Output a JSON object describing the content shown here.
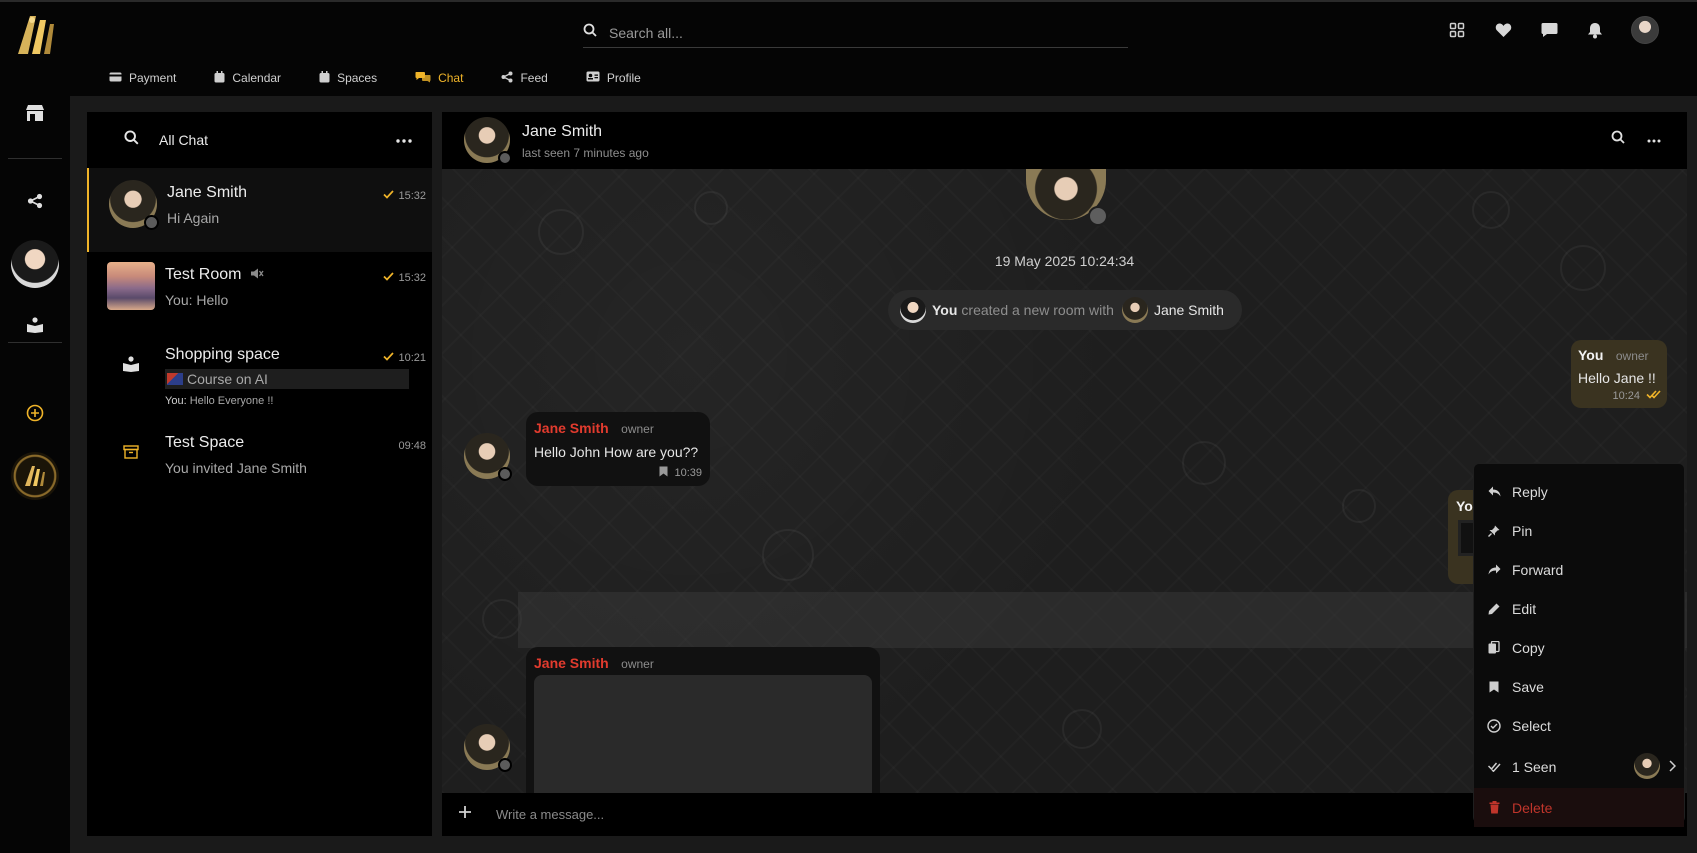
{
  "search": {
    "placeholder": "Search all..."
  },
  "tabs": [
    {
      "label": "Payment"
    },
    {
      "label": "Calendar"
    },
    {
      "label": "Spaces"
    },
    {
      "label": "Chat"
    },
    {
      "label": "Feed"
    },
    {
      "label": "Profile"
    }
  ],
  "sidebar": {
    "title": "All Chat"
  },
  "chats": [
    {
      "name": "Jane Smith",
      "preview": "Hi Again",
      "time": "15:32"
    },
    {
      "name": "Test Room",
      "preview": "You: Hello",
      "time": "15:32"
    },
    {
      "name": "Shopping space",
      "preview_box": "Course on AI",
      "preview_prefix": "You:",
      "preview": "Hello Everyone !!",
      "time": "10:21"
    },
    {
      "name": "Test Space",
      "preview": "You invited Jane Smith",
      "time": "09:48"
    }
  ],
  "chat_header": {
    "name": "Jane Smith",
    "status": "last seen 7 minutes ago"
  },
  "messages": {
    "date": "19 May 2025 10:24:34",
    "system": {
      "you": "You",
      "text": "created a new room with",
      "with": "Jane Smith"
    },
    "outgoing_1": {
      "sender": "You",
      "role": "owner",
      "text": "Hello Jane !!",
      "time": "10:24"
    },
    "incoming_1": {
      "sender": "Jane Smith",
      "role": "owner",
      "text": "Hello John How are you??",
      "time": "10:39"
    },
    "outgoing_2_peek": "You",
    "incoming_2": {
      "sender": "Jane Smith",
      "role": "owner"
    }
  },
  "composer": {
    "placeholder": "Write a message..."
  },
  "context_menu": {
    "items": [
      {
        "label": "Reply"
      },
      {
        "label": "Pin"
      },
      {
        "label": "Forward"
      },
      {
        "label": "Edit"
      },
      {
        "label": "Copy"
      },
      {
        "label": "Save"
      },
      {
        "label": "Select"
      },
      {
        "label": "1 Seen"
      },
      {
        "label": "Delete"
      }
    ]
  },
  "colors": {
    "accent": "#f0b429",
    "danger": "#e23b2e",
    "bg": "#000000"
  }
}
